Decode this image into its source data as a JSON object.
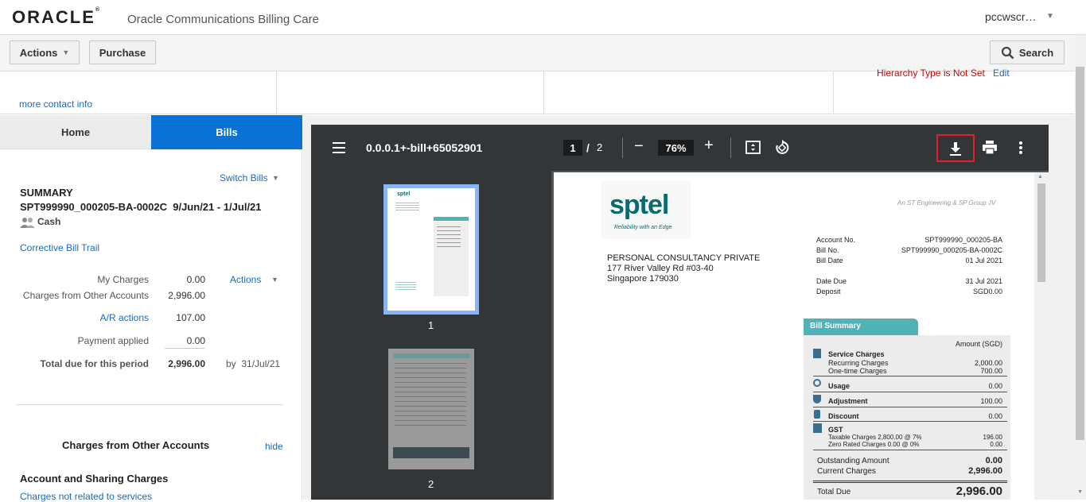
{
  "header": {
    "logo": "ORACLE",
    "app_title": "Oracle Communications Billing Care",
    "user": "pccwscr…"
  },
  "toolbar": {
    "actions_label": "Actions",
    "purchase_label": "Purchase",
    "search_label": "Search"
  },
  "info": {
    "more_contact": "more contact info",
    "hierarchy_text": "Hierarchy Type is Not Set",
    "edit_label": "Edit"
  },
  "tabs": {
    "home": "Home",
    "bills": "Bills"
  },
  "bill": {
    "switch_bills": "Switch Bills",
    "summary_heading": "SUMMARY",
    "bill_id_range": "SPT999990_000205-BA-0002C  9/Jun/21 - 1/Jul/21",
    "payment_type": "Cash",
    "corrective_trail": "Corrective Bill Trail",
    "actions_label": "Actions",
    "rows": {
      "my_charges_label": "My Charges",
      "my_charges_value": "0.00",
      "other_accounts_label": "Charges from Other Accounts",
      "other_accounts_value": "2,996.00",
      "ar_actions_label": "A/R actions",
      "ar_actions_value": "107.00",
      "payment_label": "Payment applied",
      "payment_value": "0.00",
      "total_label": "Total due for this period",
      "total_value": "2,996.00",
      "by_date": "by  31/Jul/21"
    },
    "section_title": "Charges from Other Accounts",
    "hide_label": "hide",
    "sharing_title": "Account and Sharing Charges",
    "not_related": "Charges not related to services"
  },
  "viewer": {
    "doc_title": "0.0.0.1+-bill+65052901",
    "page_current": "1",
    "page_sep": "/",
    "page_total": "2",
    "zoom": "76%",
    "thumb_1": "1",
    "thumb_2": "2"
  },
  "pdf": {
    "brand": "sptel",
    "tagline": "Reliability with an Edge",
    "jv_text": "An ST Engineering & SP Group JV",
    "addr1": "PERSONAL CONSULTANCY PRIVATE",
    "addr2": "177 River Valley Rd #03-40",
    "addr3": "Singapore 179030",
    "account_no_label": "Account No.",
    "account_no": "SPT999990_000205-BA",
    "bill_no_label": "Bill No.",
    "bill_no": "SPT999990_000205-BA-0002C",
    "bill_date_label": "Bill Date",
    "bill_date": "01 Jul 2021",
    "due_date_label": "Date Due",
    "due_date": "31 Jul 2021",
    "deposit_label": "Deposit",
    "deposit": "SGD0.00",
    "summary_tab": "Bill Summary",
    "amount_header": "Amount (SGD)",
    "service_charges": "Service Charges",
    "recurring_label": "Recurring Charges",
    "recurring": "2,000.00",
    "onetime_label": "One-time Charges",
    "onetime": "700.00",
    "usage_label": "Usage",
    "usage": "0.00",
    "adjustment_label": "Adjustment",
    "adjustment": "100.00",
    "discount_label": "Discount",
    "discount": "0.00",
    "gst_label": "GST",
    "taxable_label": "Taxable Charges 2,800.00 @ 7%",
    "taxable": "196.00",
    "zero_label": "Zero Rated Charges 0.00 @ 0%",
    "zero": "0.00",
    "outstanding_label": "Outstanding Amount",
    "outstanding": "0.00",
    "current_label": "Current Charges",
    "current": "2,996.00",
    "total_due_label": "Total Due",
    "total_due": "2,996.00"
  },
  "colors": {
    "accent": "#0a74d6",
    "teal": "#4fb3b8",
    "highlight": "#e0202a",
    "error": "#cc0000"
  }
}
